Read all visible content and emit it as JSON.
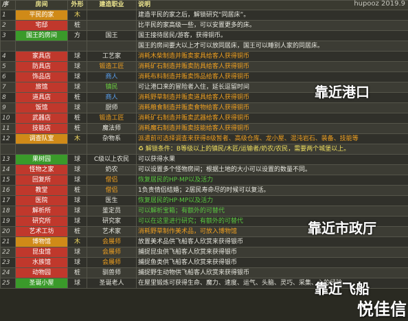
{
  "brand": "hupooz 2019.9",
  "headers": {
    "seq": "序",
    "room": "房间",
    "shape": "外形",
    "job": "建造职业",
    "desc": "说明"
  },
  "rows": [
    {
      "seq": "1",
      "room": "平民的家",
      "shape": "木",
      "job": "",
      "desc": "建造平民的家之后，解锁研究“同居床”。",
      "room_style": "orange",
      "desc_color": "white"
    },
    {
      "seq": "2",
      "room": "宅邸",
      "shape": "桩",
      "job": "",
      "desc": "比平民的家高级一些，可以安置更多的床。",
      "room_style": "red",
      "desc_color": "white"
    },
    {
      "seq": "3",
      "room": "国王的房间",
      "shape": "方",
      "job": "国王",
      "desc": "国王接待居民/游客，获得铜币。",
      "room_style": "green",
      "desc_color": "white"
    },
    {
      "seq": "",
      "room": "",
      "shape": "",
      "job": "",
      "desc": "国王的房间要大以上才可以放同居床，国王可以睡别人家的同居床。",
      "room_style": "green",
      "desc_color": "white"
    },
    {
      "seq": "4",
      "room": "家具店",
      "shape": "球",
      "job": "工艺家",
      "desc": "消耗木柴制造并贩卖家具给客人获得铜币",
      "room_style": "red",
      "desc_color": "orange",
      "job_color": "white"
    },
    {
      "seq": "5",
      "room": "防具店",
      "shape": "球",
      "job": "锻造工匠",
      "desc": "消耗矿石制造并贩卖防具给客人获得铜币",
      "room_style": "red",
      "desc_color": "orange",
      "job_color": "orange"
    },
    {
      "seq": "6",
      "room": "饰品店",
      "shape": "球",
      "job": "商人",
      "desc": "消耗布料制造并贩卖饰品给客人获得铜币",
      "room_style": "red",
      "desc_color": "orange",
      "job_color": "blue"
    },
    {
      "seq": "7",
      "room": "旅馆",
      "shape": "球",
      "job": "镇民",
      "desc": "可让港口来的冒险者入住，延长逗留时间",
      "room_style": "red",
      "desc_color": "white",
      "job_color": "green"
    },
    {
      "seq": "8",
      "room": "道具店",
      "shape": "桩",
      "job": "商人",
      "desc": "消耗野草制造并贩卖道具给客人获得铜币",
      "room_style": "red",
      "desc_color": "orange",
      "job_color": "blue"
    },
    {
      "seq": "9",
      "room": "饭馆",
      "shape": "球",
      "job": "厨师",
      "desc": "消耗粮食制造并贩卖食物给客人获得铜币",
      "room_style": "red",
      "desc_color": "orange",
      "job_color": "white"
    },
    {
      "seq": "10",
      "room": "武器店",
      "shape": "桩",
      "job": "锻造工匠",
      "desc": "消耗矿石制造并贩卖武器给客人获得铜币",
      "room_style": "red",
      "desc_color": "orange",
      "job_color": "orange"
    },
    {
      "seq": "11",
      "room": "技能店",
      "shape": "桩",
      "job": "魔法师",
      "desc": "消耗魔石制造并贩卖技能给客人获得铜币",
      "room_style": "red",
      "desc_color": "orange",
      "job_color": "white"
    },
    {
      "seq": "12",
      "room": "调查队室",
      "shape": "木",
      "job": "杂物系",
      "desc": "派遣前可选择调查来获得8级暂者、高级仓库、龙小屋、混沌岩石、装备、技能等",
      "room_style": "orange",
      "desc_color": "orange",
      "job_color": "white"
    },
    {
      "seq": "",
      "room": "",
      "shape": "",
      "job": "",
      "desc": "♻ 解锁条件：B等级以上的镇民/木匠/运输者/奶农/农民，需要两个城堡以上。",
      "room_style": "orange",
      "desc_color": "yellow"
    },
    {
      "seq": "13",
      "room": "果树园",
      "shape": "球",
      "job": "C级以上农民",
      "desc": "可以获得水果",
      "room_style": "green",
      "desc_color": "white",
      "job_color": "white"
    },
    {
      "seq": "14",
      "room": "怪物之家",
      "shape": "球",
      "job": "奶农",
      "desc": "可以设置多个怪物房间；根据土地的大小可以设置的数量不同。",
      "room_style": "red",
      "desc_color": "white",
      "job_color": "white"
    },
    {
      "seq": "15",
      "room": "回复所",
      "shape": "球",
      "job": "僧侣",
      "desc": "恢复居民的HP·MP以及活力",
      "room_style": "red",
      "desc_color": "green",
      "job_color": "orange"
    },
    {
      "seq": "16",
      "room": "教堂",
      "shape": "桩",
      "job": "僧侣",
      "desc": "1负责情侣结婚；2居民寿命尽的时候可以复活。",
      "room_style": "red",
      "desc_color": "white",
      "job_color": "orange"
    },
    {
      "seq": "17",
      "room": "医院",
      "shape": "球",
      "job": "医生",
      "desc": "恢复居民的HP·MP以及活力",
      "room_style": "red",
      "desc_color": "green",
      "job_color": "white"
    },
    {
      "seq": "18",
      "room": "解析所",
      "shape": "球",
      "job": "鉴定员",
      "desc": "可以解析宝箱；有额外的可替代",
      "room_style": "red",
      "desc_color": "green",
      "job_color": "white"
    },
    {
      "seq": "19",
      "room": "研究所",
      "shape": "球",
      "job": "研究家",
      "desc": "可以在这里进行研究；有额外的可替代",
      "room_style": "red",
      "desc_color": "green",
      "job_color": "white"
    },
    {
      "seq": "20",
      "room": "艺术工坊",
      "shape": "桩",
      "job": "艺术家",
      "desc": "消耗野草制作美术品，可放入博物馆",
      "room_style": "red",
      "desc_color": "orange",
      "job_color": "white"
    },
    {
      "seq": "21",
      "room": "博物馆",
      "shape": "木",
      "job": "会展师",
      "desc": "放置美术品供飞船客人欣赏来获得银币",
      "room_style": "orange",
      "desc_color": "white",
      "job_color": "orange"
    },
    {
      "seq": "22",
      "room": "昆虫馆",
      "shape": "球",
      "job": "会展师",
      "desc": "捕捉昆虫供飞船客人欣赏来获得银币",
      "room_style": "red",
      "desc_color": "white",
      "job_color": "orange"
    },
    {
      "seq": "23",
      "room": "水族馆",
      "shape": "球",
      "job": "会展师",
      "desc": "捕捉鱼类供飞船客人欣赏来获得银币",
      "room_style": "red",
      "desc_color": "white",
      "job_color": "orange"
    },
    {
      "seq": "24",
      "room": "动物园",
      "shape": "桩",
      "job": "驯兽师",
      "desc": "捕捉野生动物供飞船客人欣赏来获得银币",
      "room_style": "red",
      "desc_color": "white",
      "job_color": "white"
    },
    {
      "seq": "25",
      "room": "圣诞小屋",
      "shape": "球",
      "job": "圣诞老人",
      "desc": "在屋里锻炼可获得生命、魔力、速度、运气、头脑、灵巧、采集、心的经验",
      "room_style": "green",
      "desc_color": "white",
      "job_color": "white"
    }
  ],
  "tags": {
    "port": "靠近港口",
    "city_hall": "靠近市政厅",
    "airship": "靠近飞船"
  },
  "logo": "悦佳信"
}
